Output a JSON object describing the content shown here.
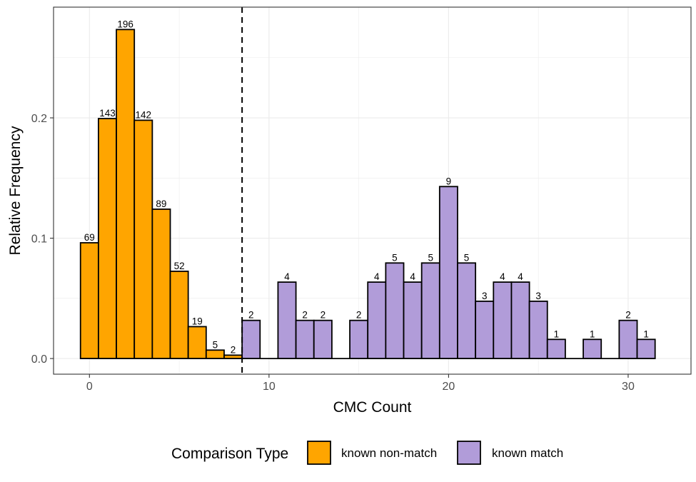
{
  "chart_data": {
    "type": "bar",
    "subtype": "histogram",
    "title": "",
    "xlabel": "CMC Count",
    "ylabel": "Relative Frequency",
    "xlim": [
      -2,
      33.5
    ],
    "ylim": [
      -0.013,
      0.292
    ],
    "x_ticks": [
      0,
      10,
      20,
      30
    ],
    "x_tick_labels": [
      "0",
      "10",
      "20",
      "30"
    ],
    "y_ticks": [
      0.0,
      0.1,
      0.2
    ],
    "y_tick_labels": [
      "0.0",
      "0.1",
      "0.2"
    ],
    "grid": true,
    "bin_width": 1,
    "threshold_line": {
      "x": 8.5,
      "style": "dashed"
    },
    "legend": {
      "title": "Comparison Type",
      "position": "bottom"
    },
    "series": [
      {
        "name": "known non-match",
        "color": "#FFA500",
        "x": [
          0,
          1,
          2,
          3,
          4,
          5,
          6,
          7,
          8
        ],
        "counts": [
          69,
          143,
          196,
          142,
          89,
          52,
          19,
          5,
          2
        ],
        "values": [
          0.0962,
          0.1994,
          0.2734,
          0.198,
          0.1241,
          0.0725,
          0.0265,
          0.007,
          0.0028
        ]
      },
      {
        "name": "known match",
        "color": "#B19CD9",
        "x": [
          9,
          11,
          12,
          13,
          15,
          16,
          17,
          18,
          19,
          20,
          21,
          22,
          23,
          24,
          25,
          26,
          28,
          30,
          31
        ],
        "counts": [
          2,
          4,
          2,
          2,
          2,
          4,
          5,
          4,
          5,
          9,
          5,
          3,
          4,
          4,
          3,
          1,
          1,
          2,
          1
        ],
        "values": [
          0.0317,
          0.0635,
          0.0317,
          0.0317,
          0.0317,
          0.0635,
          0.0794,
          0.0635,
          0.0794,
          0.1429,
          0.0794,
          0.0476,
          0.0635,
          0.0635,
          0.0476,
          0.0159,
          0.0159,
          0.0317,
          0.0159
        ]
      }
    ]
  }
}
